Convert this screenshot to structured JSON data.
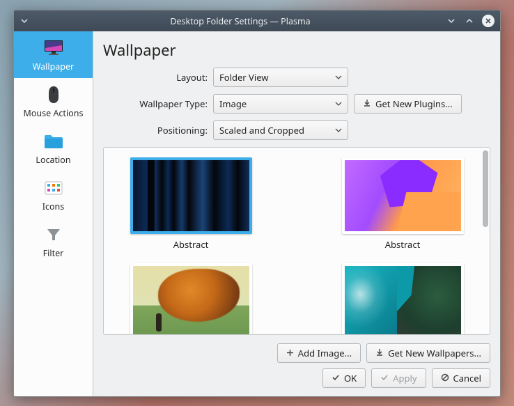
{
  "window": {
    "title": "Desktop Folder Settings — Plasma"
  },
  "sidebar": {
    "items": [
      {
        "label": "Wallpaper"
      },
      {
        "label": "Mouse Actions"
      },
      {
        "label": "Location"
      },
      {
        "label": "Icons"
      },
      {
        "label": "Filter"
      }
    ]
  },
  "main": {
    "heading": "Wallpaper",
    "form": {
      "layout_label": "Layout:",
      "layout_value": "Folder View",
      "type_label": "Wallpaper Type:",
      "type_value": "Image",
      "get_plugins": "Get New Plugins...",
      "positioning_label": "Positioning:",
      "positioning_value": "Scaled and Cropped"
    },
    "gallery": {
      "items": [
        {
          "caption": "Abstract"
        },
        {
          "caption": "Abstract"
        },
        {
          "caption": ""
        },
        {
          "caption": ""
        }
      ]
    },
    "buttons": {
      "add_image": "Add Image...",
      "get_wallpapers": "Get New Wallpapers...",
      "ok": "OK",
      "apply": "Apply",
      "cancel": "Cancel"
    }
  }
}
